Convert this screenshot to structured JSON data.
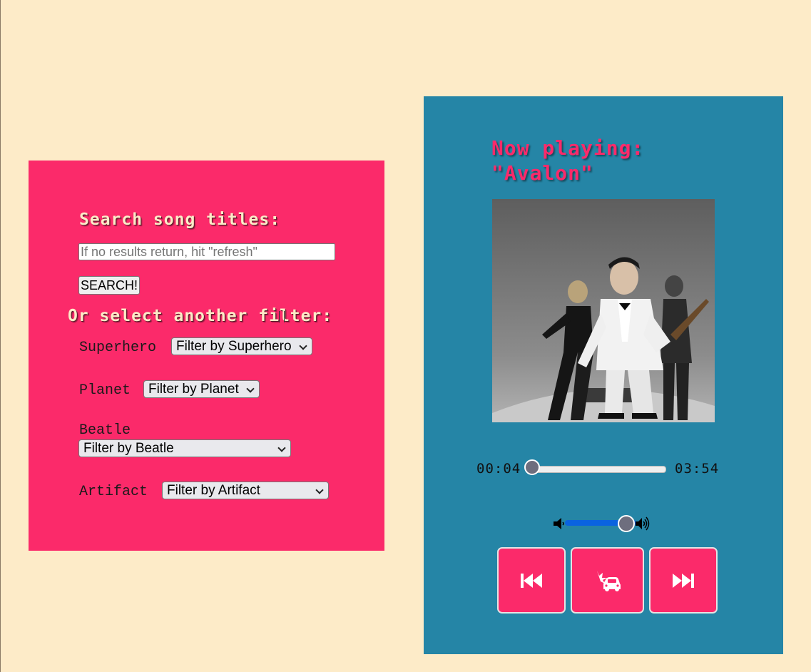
{
  "search": {
    "heading": "Search song titles:",
    "placeholder": "If no results return, hit \"refresh\"",
    "button_label": "SEARCH!"
  },
  "filters": {
    "heading": "Or select another filter:",
    "superhero": {
      "label": "Superhero",
      "selected": "Filter by Superhero"
    },
    "planet": {
      "label": "Planet",
      "selected": "Filter by Planet"
    },
    "beatle": {
      "label": "Beatle",
      "selected": "Filter by Beatle"
    },
    "artifact": {
      "label": "Artifact",
      "selected": "Filter by Artifact"
    }
  },
  "player": {
    "now_playing_label": "Now playing:",
    "song_title": "\"Avalon\"",
    "current_time": "00:04",
    "duration": "03:54",
    "progress_fraction": 0.017,
    "volume_fraction": 0.8
  },
  "icons": {
    "previous": "skip-back-icon",
    "shuffle": "car-crash-icon",
    "next": "skip-forward-icon",
    "volume_low": "speaker-low-icon",
    "volume_high": "speaker-high-icon"
  },
  "colors": {
    "background": "#fdebc8",
    "search_panel": "#fb2a6a",
    "player_panel": "#2585a6",
    "accent_text": "#fdebc8",
    "now_playing_text": "#fb2a6a",
    "volume_fill": "#0a63e0"
  }
}
